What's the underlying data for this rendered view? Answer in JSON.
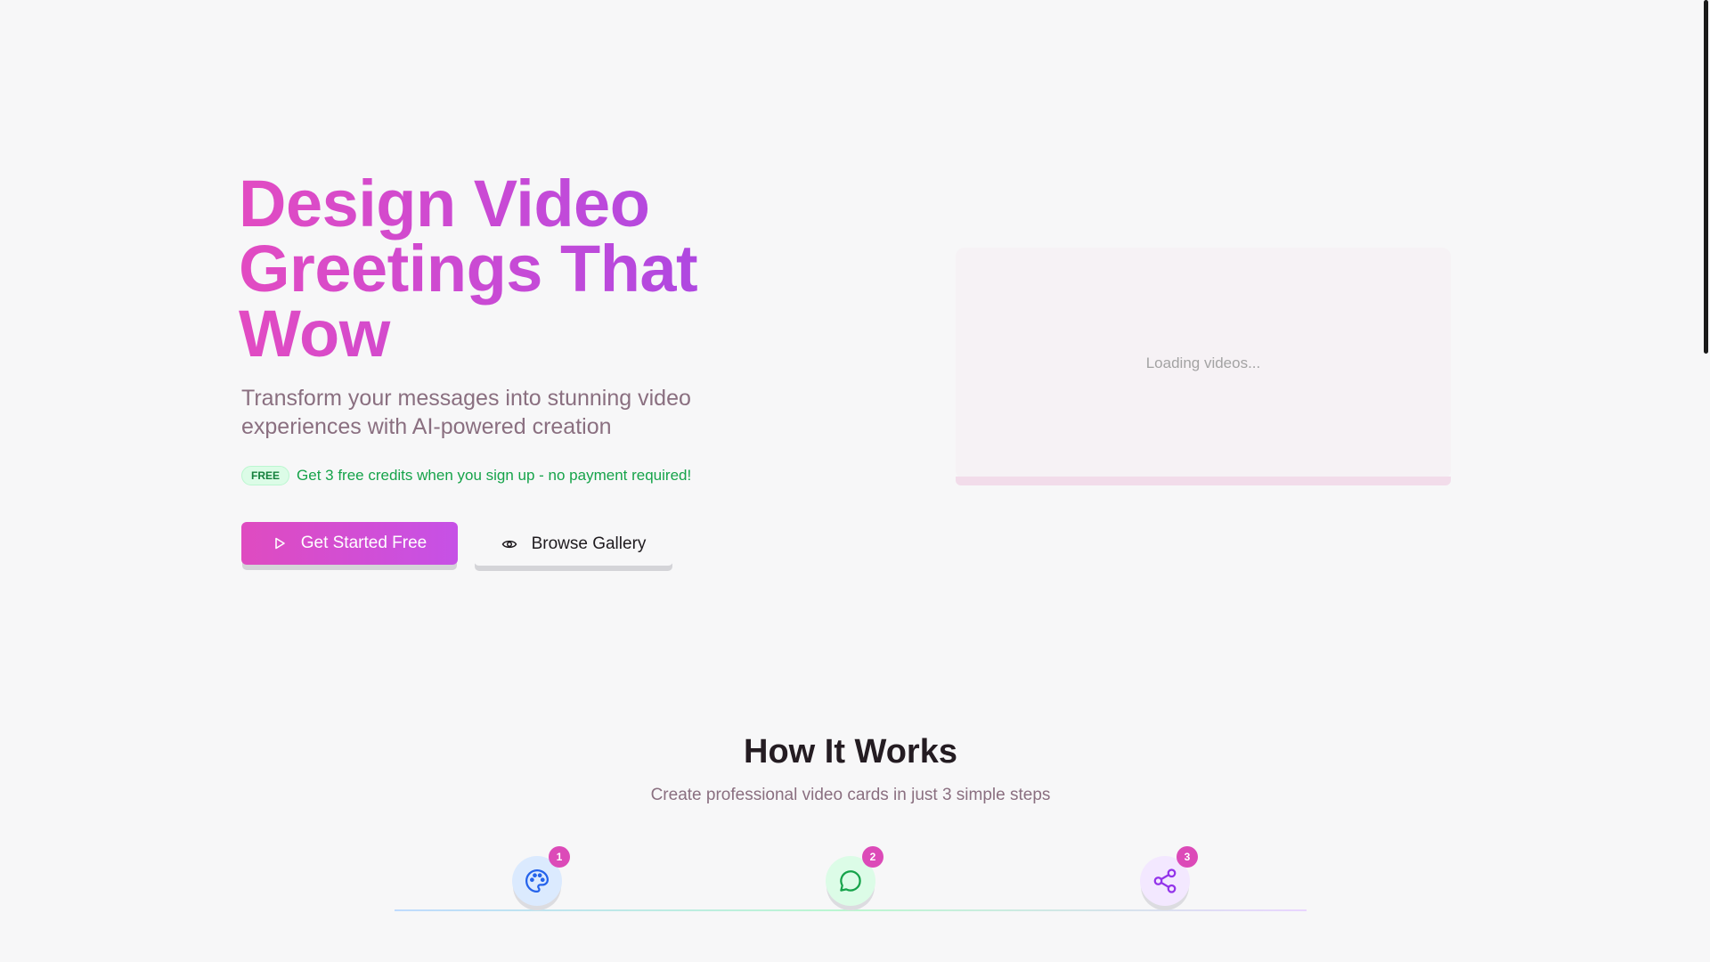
{
  "hero": {
    "title_line1": "Design Video",
    "title_line2": "Greetings That",
    "title_line3": "Wow",
    "subtitle": "Transform your messages into stunning video experiences with AI-powered creation",
    "free_badge": "FREE",
    "free_text": "Get 3 free credits when you sign up - no payment required!",
    "primary_button": {
      "label": "Get Started Free",
      "icon": "play-icon"
    },
    "secondary_button": {
      "label": "Browse Gallery",
      "icon": "eye-icon"
    },
    "video_panel": {
      "loading_text": "Loading videos..."
    }
  },
  "how_it_works": {
    "title": "How It Works",
    "subtitle": "Create professional video cards in just 3 simple steps",
    "steps": [
      {
        "number": "1",
        "icon": "palette-icon",
        "color": "#2563eb"
      },
      {
        "number": "2",
        "icon": "chat-bubble-icon",
        "color": "#16a34a"
      },
      {
        "number": "3",
        "icon": "share-icon",
        "color": "#9333ea"
      }
    ]
  },
  "colors": {
    "brand_pink": "#df4bc0",
    "brand_purple": "#a247e6",
    "success_green": "#16a34a"
  }
}
